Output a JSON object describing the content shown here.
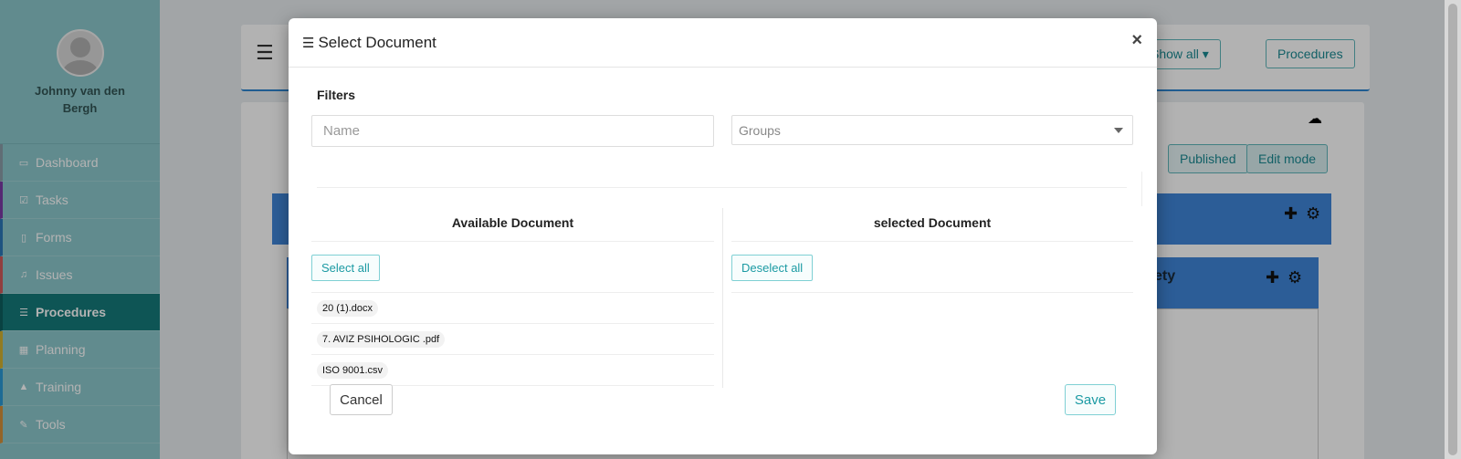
{
  "sidebar": {
    "user_name": "Johnny van den Bergh",
    "items": [
      {
        "label": "Dashboard",
        "icon": "monitor-icon"
      },
      {
        "label": "Tasks",
        "icon": "checkbox-icon"
      },
      {
        "label": "Forms",
        "icon": "document-icon"
      },
      {
        "label": "Issues",
        "icon": "bell-icon"
      },
      {
        "label": "Procedures",
        "icon": "list-icon"
      },
      {
        "label": "Planning",
        "icon": "calendar-icon"
      },
      {
        "label": "Training",
        "icon": "graduation-cap-icon"
      },
      {
        "label": "Tools",
        "icon": "wrench-icon"
      }
    ],
    "active_item": "Procedures"
  },
  "background": {
    "show_all_label": "Show all",
    "procedures_button": "Procedures",
    "published_button": "Published",
    "edit_mode_button": "Edit mode",
    "partial_text": "ety"
  },
  "modal": {
    "title": "Select Document",
    "close_label": "×",
    "filters_label": "Filters",
    "name_placeholder": "Name",
    "groups_placeholder": "Groups",
    "available_header": "Available Document",
    "selected_header": "selected Document",
    "select_all": "Select all",
    "deselect_all": "Deselect all",
    "available_documents": [
      "20 (1).docx",
      "7. AVIZ PSIHOLOGIC .pdf",
      "ISO 9001.csv"
    ],
    "selected_documents": [],
    "cancel": "Cancel",
    "save": "Save"
  },
  "colors": {
    "sidebar_bg": "#8cc8cc",
    "sidebar_active": "#157a7a",
    "accent_teal": "#1b9aa3",
    "panel_blue": "#3f86d8"
  }
}
